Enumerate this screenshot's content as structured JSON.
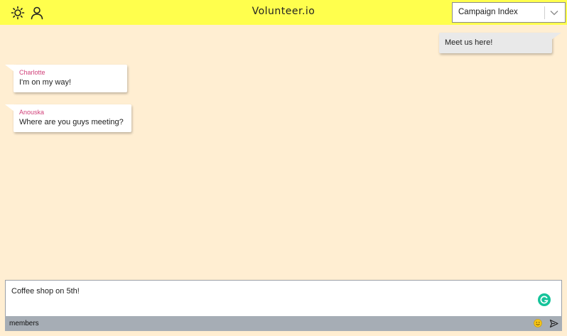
{
  "header": {
    "app_title": "Volunteer.io",
    "icons": {
      "theme": "sun-icon",
      "profile": "user-icon",
      "dropdown": "chevron-down-icon"
    },
    "campaign_select": {
      "selected": "Campaign Index"
    },
    "accent_color": "#ffff4d"
  },
  "chat": {
    "background_color": "#ffeed2",
    "messages": [
      {
        "sender": "",
        "text": "Meet us here!",
        "own": true
      },
      {
        "sender": "Charlotte",
        "text": "I'm on my way!",
        "own": false
      },
      {
        "sender": "Anouska",
        "text": "Where are you guys meeting?",
        "own": false
      }
    ],
    "sender_color": "#d1427a"
  },
  "composer": {
    "draft": "Coffee shop on 5th!",
    "members_label": "members",
    "icons": {
      "grammarly": "grammarly-icon",
      "emoji": "emoji-icon",
      "send": "send-icon"
    }
  }
}
